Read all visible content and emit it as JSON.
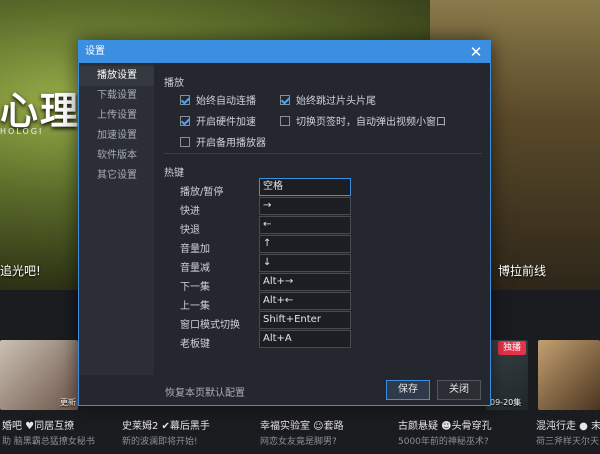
{
  "background": {
    "hero_title": "心理师",
    "hero_subtitle": "HOLOGI",
    "caption_left": "追光吧!",
    "caption_right": "博拉前线",
    "card_update_label": "更新",
    "card_episodes_label": "09-20集",
    "card_badge": "独播",
    "titles": [
      {
        "title": "婚吧 ♥同居互撩",
        "subtitle": "助 脑黑霸总猛撩女秘书"
      },
      {
        "title": "史莱姆2 ✔幕后黑手",
        "subtitle": "新的波澜即将开始!"
      },
      {
        "title": "幸福实验室 ☺套路",
        "subtitle": "网恋女友竟是脚男?"
      },
      {
        "title": "古颜悬疑 ☻头骨穿孔",
        "subtitle": "5000年前的神秘巫术?"
      },
      {
        "title": "混沌行走 ● 末",
        "subtitle": "荷三斧样天尔天"
      }
    ]
  },
  "dialog": {
    "title": "设置",
    "close_symbol": "✕",
    "sidebar": [
      {
        "label": "播放设置",
        "active": true
      },
      {
        "label": "下载设置",
        "active": false
      },
      {
        "label": "上传设置",
        "active": false
      },
      {
        "label": "加速设置",
        "active": false
      },
      {
        "label": "软件版本",
        "active": false
      },
      {
        "label": "其它设置",
        "active": false
      }
    ],
    "playback": {
      "section_title": "播放",
      "options": [
        {
          "label": "始终自动连播",
          "checked": true
        },
        {
          "label": "始终跳过片头片尾",
          "checked": true
        },
        {
          "label": "开启硬件加速",
          "checked": true
        },
        {
          "label": "切换页签时，自动弹出视频小窗口",
          "checked": false
        },
        {
          "label": "开启备用播放器",
          "checked": false
        }
      ]
    },
    "hotkeys": {
      "section_title": "热键",
      "items": [
        {
          "label": "播放/暂停",
          "value": "空格"
        },
        {
          "label": "快进",
          "value": "→"
        },
        {
          "label": "快退",
          "value": "←"
        },
        {
          "label": "音量加",
          "value": "↑"
        },
        {
          "label": "音量减",
          "value": "↓"
        },
        {
          "label": "下一集",
          "value": "Alt+→"
        },
        {
          "label": "上一集",
          "value": "Alt+←"
        },
        {
          "label": "窗口模式切换",
          "value": "Shift+Enter"
        },
        {
          "label": "老板键",
          "value": "Alt+A"
        }
      ]
    },
    "footer": {
      "restore_label": "恢复本页默认配置",
      "save_label": "保存",
      "cancel_label": "关闭"
    }
  }
}
